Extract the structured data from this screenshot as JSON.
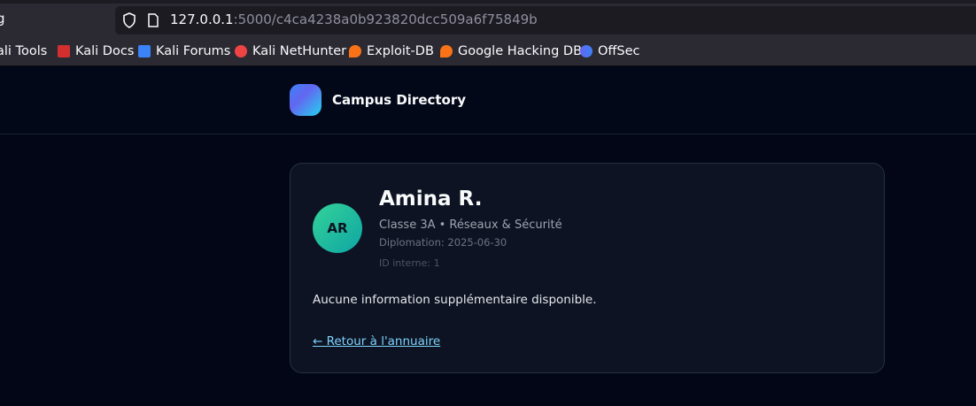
{
  "browser": {
    "tab_fragment": "g",
    "url_host": "127.0.0.1",
    "url_path": ":5000/c4ca4238a0b923820dcc509a6f75849b",
    "bookmarks": [
      {
        "label": "ali Tools",
        "icon": "kali-tools-icon"
      },
      {
        "label": "Kali Docs",
        "icon": "kali-docs-icon",
        "color": "#d32f2f"
      },
      {
        "label": "Kali Forums",
        "icon": "kali-forums-icon",
        "color": "#3b82f6"
      },
      {
        "label": "Kali NetHunter",
        "icon": "nethunter-icon",
        "color": "#ef4444"
      },
      {
        "label": "Exploit-DB",
        "icon": "exploit-db-icon",
        "color": "#f97316"
      },
      {
        "label": "Google Hacking DB",
        "icon": "ghdb-icon",
        "color": "#f97316"
      },
      {
        "label": "OffSec",
        "icon": "offsec-icon",
        "color": "#6366f1"
      }
    ]
  },
  "header": {
    "brand": "Campus Directory"
  },
  "profile": {
    "initials": "AR",
    "name": "Amina R.",
    "subtitle": "Classe 3A • Réseaux & Sécurité",
    "graduation": "Diplomation: 2025-06-30",
    "internal_id": "ID interne: 1",
    "info": "Aucune information supplémentaire disponible.",
    "back_link": "← Retour à l'annuaire"
  },
  "colors": {
    "background": "#020617",
    "card": "#0d1322",
    "link": "#7dd3fc",
    "avatar": "#2dd4bf"
  }
}
